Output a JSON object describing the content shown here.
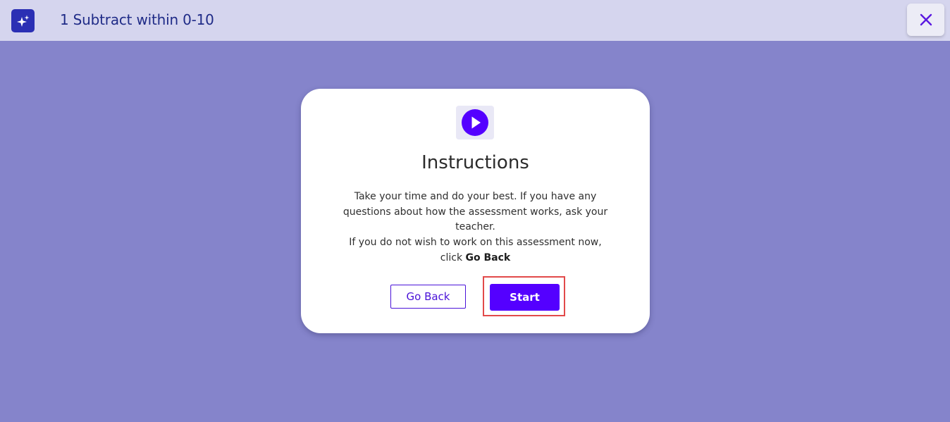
{
  "header": {
    "logo_icon": "sparkles-icon",
    "title": "1 Subtract within 0-10",
    "close_icon": "close-icon"
  },
  "dialog": {
    "icon": "play-circle-icon",
    "title": "Instructions",
    "body_line_1": "Take your time and do your best. If you have any questions about how the assessment works, ask your teacher.",
    "body_line_2_prefix": "If you do not wish to work on this assessment now, click ",
    "body_line_2_emphasis": "Go Back",
    "go_back_label": "Go Back",
    "start_label": "Start"
  },
  "colors": {
    "page_background": "#8584cb",
    "header_background": "#d5d5ee",
    "accent": "#5400ff",
    "focus_outline": "#e24a4a"
  }
}
